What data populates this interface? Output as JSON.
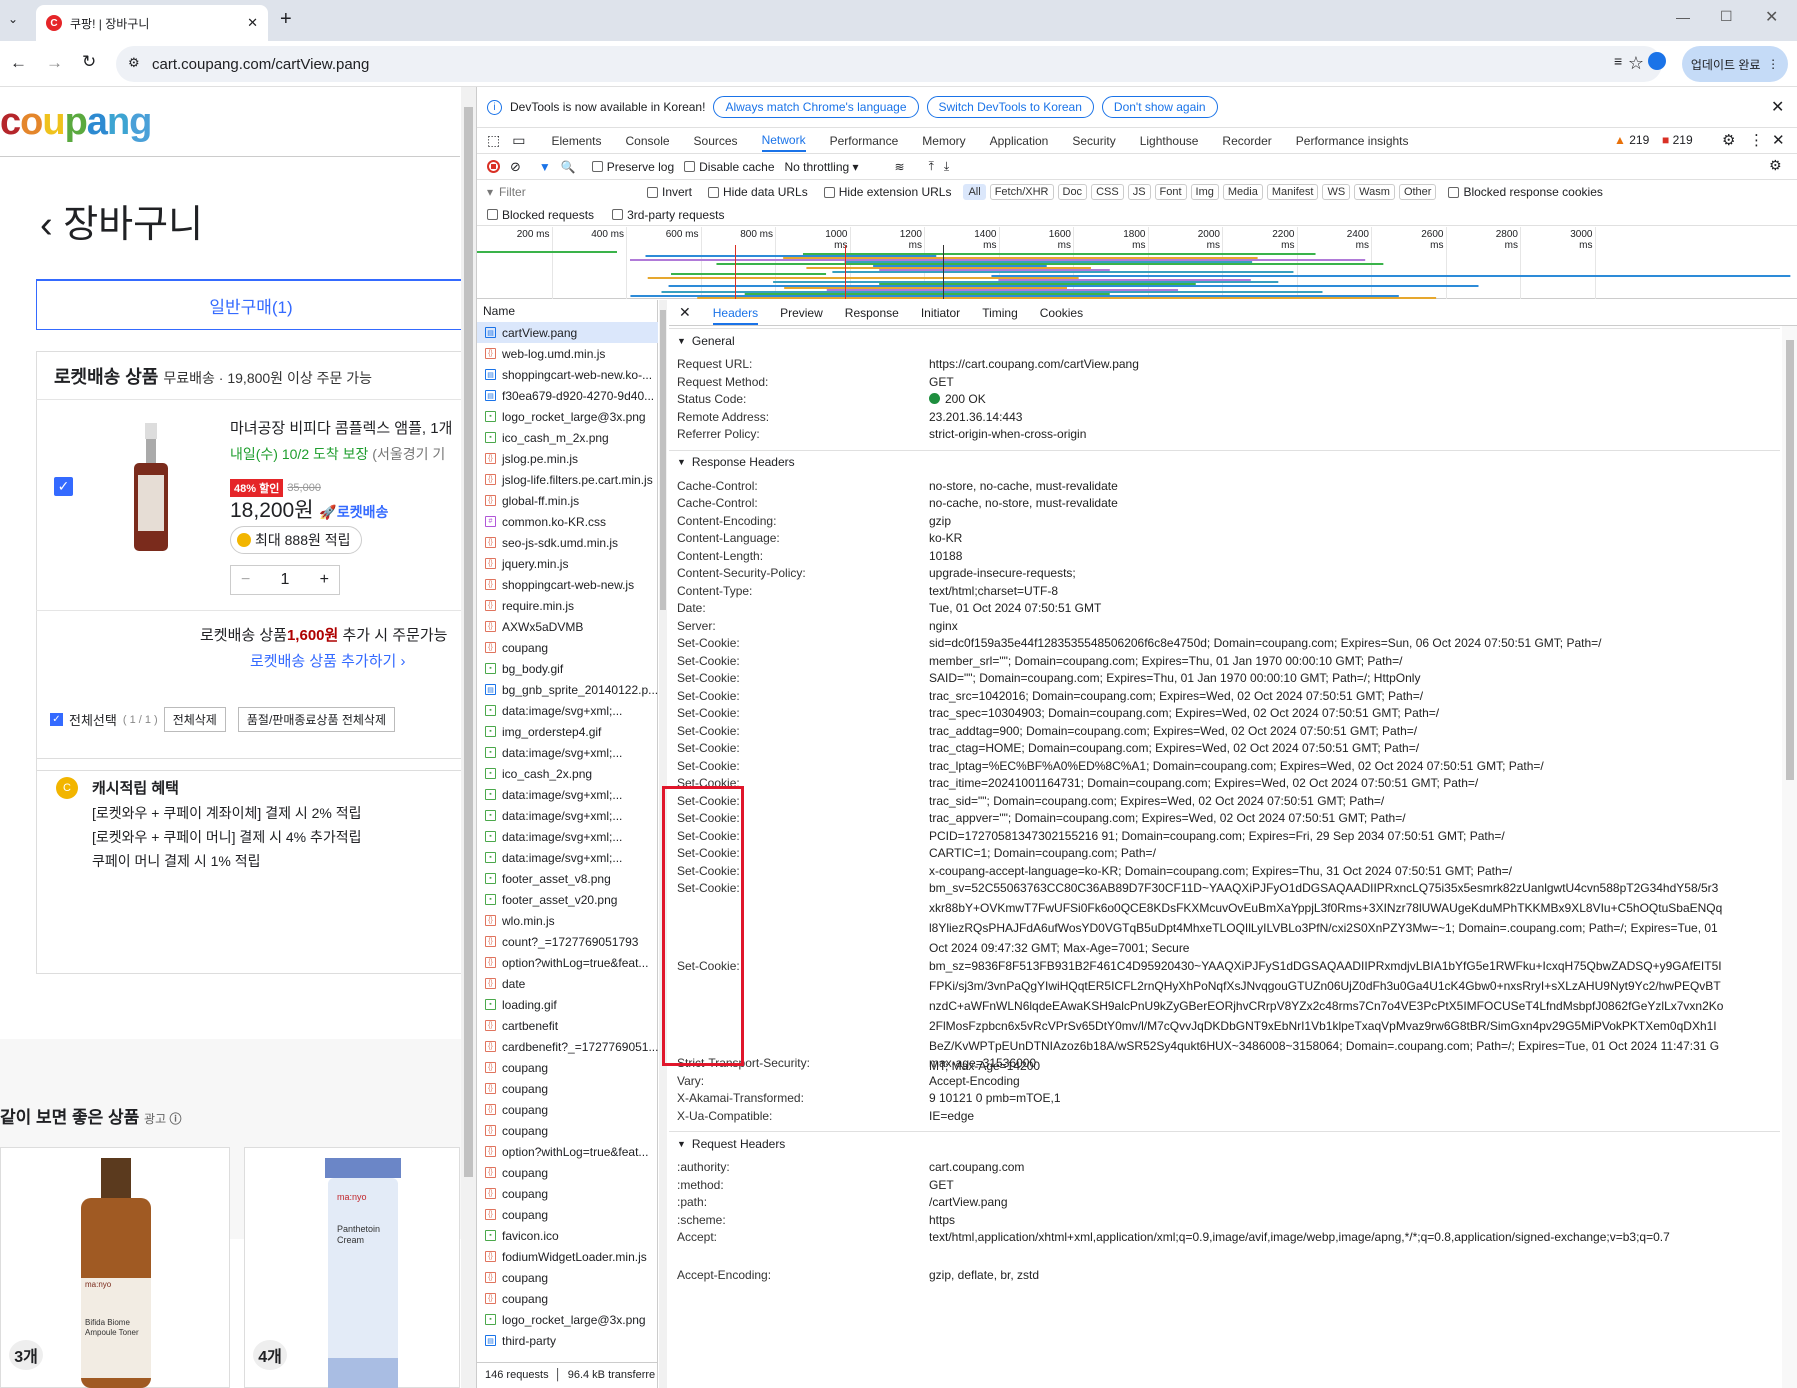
{
  "browser": {
    "tab_title": "쿠팡! | 장바구니",
    "url": "cart.coupang.com/cartView.pang",
    "update_label": "업데이트 완료"
  },
  "page": {
    "logo": "coupang",
    "heading": "장바구니",
    "tab_general": "일반구매(1)",
    "rocket_title": "로켓배송 상품",
    "rocket_sub": "무료배송 · 19,800원 이상 주문 가능",
    "product_name": "마녀공장 비피다 콤플렉스 앰플, 1개",
    "delivery": "내일(수) 10/2 도착 보장",
    "delivery_region": "(서울경기 기",
    "discount_badge": "48% 할인",
    "original_price": "35,000",
    "price": "18,200원",
    "rocket_badge": "로켓배송",
    "points": "최대 888원 적립",
    "qty": "1",
    "add_notice_a": "로켓배송 상품",
    "add_notice_amount": "1,600원",
    "add_notice_b": "추가 시 주문가능",
    "add_more": "로켓배송 상품 추가하기 ›",
    "select_all": "전체선택",
    "select_count": "( 1 / 1 )",
    "delete_all": "전체삭제",
    "delete_soldout": "품절/판매종료상품 전체삭제",
    "cash_title": "캐시적립 혜택",
    "cash_lines": [
      "[로켓와우 + 쿠페이 계좌이체] 결제 시 2% 적립",
      "[로켓와우 + 쿠페이 머니] 결제 시 4% 추가적립",
      "쿠페이 머니 결제 시 1% 적립"
    ],
    "reco_title": "같이 보면 좋은 상품",
    "reco_ad": "광고",
    "reco_counts": [
      "3개",
      "4개"
    ],
    "reco_labels": [
      "ma:nyo",
      "ma:nyo"
    ],
    "reco_names": [
      "Bifida Biome Ampoule Toner",
      "Panthetoin Cream"
    ]
  },
  "devtools": {
    "banner": "DevTools is now available in Korean!",
    "btn_match": "Always match Chrome's language",
    "btn_switch": "Switch DevTools to Korean",
    "btn_dont": "Don't show again",
    "tabs": [
      "Elements",
      "Console",
      "Sources",
      "Network",
      "Performance",
      "Memory",
      "Application",
      "Security",
      "Lighthouse",
      "Recorder",
      "Performance insights"
    ],
    "warn_count": "219",
    "err_count": "219",
    "preserve_log": "Preserve log",
    "disable_cache": "Disable cache",
    "throttling": "No throttling",
    "filter_placeholder": "Filter",
    "invert": "Invert",
    "hide_data": "Hide data URLs",
    "hide_ext": "Hide extension URLs",
    "filter_types": [
      "All",
      "Fetch/XHR",
      "Doc",
      "CSS",
      "JS",
      "Font",
      "Img",
      "Media",
      "Manifest",
      "WS",
      "Wasm",
      "Other"
    ],
    "blocked_cookies": "Blocked response cookies",
    "blocked_req": "Blocked requests",
    "third_party": "3rd-party requests",
    "timeline_ticks": [
      "200 ms",
      "400 ms",
      "600 ms",
      "800 ms",
      "1000 ms",
      "1200 ms",
      "1400 ms",
      "1600 ms",
      "1800 ms",
      "2000 ms",
      "2200 ms",
      "2400 ms",
      "2600 ms",
      "2800 ms",
      "3000 ms"
    ],
    "name_header": "Name",
    "requests": [
      "cartView.pang",
      "web-log.umd.min.js",
      "shoppingcart-web-new.ko-...",
      "f30ea679-d920-4270-9d40...",
      "logo_rocket_large@3x.png",
      "ico_cash_m_2x.png",
      "jslog.pe.min.js",
      "jslog-life.filters.pe.cart.min.js",
      "global-ff.min.js",
      "common.ko-KR.css",
      "seo-js-sdk.umd.min.js",
      "jquery.min.js",
      "shoppingcart-web-new.js",
      "require.min.js",
      "AXWx5aDVMB",
      "coupang",
      "bg_body.gif",
      "bg_gnb_sprite_20140122.p...",
      "data:image/svg+xml;...",
      "img_orderstep4.gif",
      "data:image/svg+xml;...",
      "ico_cash_2x.png",
      "data:image/svg+xml;...",
      "data:image/svg+xml;...",
      "data:image/svg+xml;...",
      "data:image/svg+xml;...",
      "footer_asset_v8.png",
      "footer_asset_v20.png",
      "wlo.min.js",
      "count?_=1727769051793",
      "option?withLog=true&feat...",
      "date",
      "loading.gif",
      "cartbenefit",
      "cardbenefit?_=1727769051...",
      "coupang",
      "coupang",
      "coupang",
      "coupang",
      "option?withLog=true&feat...",
      "coupang",
      "coupang",
      "coupang",
      "favicon.ico",
      "fodiumWidgetLoader.min.js",
      "coupang",
      "coupang",
      "logo_rocket_large@3x.png",
      "third-party"
    ],
    "summary_requests": "146 requests",
    "summary_transferred": "96.4 kB transferre",
    "detail_tabs": [
      "Headers",
      "Preview",
      "Response",
      "Initiator",
      "Timing",
      "Cookies"
    ],
    "general_title": "General",
    "general": [
      [
        "Request URL:",
        "https://cart.coupang.com/cartView.pang"
      ],
      [
        "Request Method:",
        "GET"
      ],
      [
        "Status Code:",
        "200 OK"
      ],
      [
        "Remote Address:",
        "23.201.36.14:443"
      ],
      [
        "Referrer Policy:",
        "strict-origin-when-cross-origin"
      ]
    ],
    "response_title": "Response Headers",
    "response": [
      [
        "Cache-Control:",
        "no-store, no-cache, must-revalidate"
      ],
      [
        "Cache-Control:",
        "no-cache, no-store, must-revalidate"
      ],
      [
        "Content-Encoding:",
        "gzip"
      ],
      [
        "Content-Language:",
        "ko-KR"
      ],
      [
        "Content-Length:",
        "10188"
      ],
      [
        "Content-Security-Policy:",
        "upgrade-insecure-requests;"
      ],
      [
        "Content-Type:",
        "text/html;charset=UTF-8"
      ],
      [
        "Date:",
        "Tue, 01 Oct 2024 07:50:51 GMT"
      ],
      [
        "Server:",
        "nginx"
      ],
      [
        "Set-Cookie:",
        "sid=dc0f159a35e44f1283535548506206f6c8e4750d; Domain=coupang.com; Expires=Sun, 06 Oct 2024 07:50:51 GMT; Path=/"
      ],
      [
        "Set-Cookie:",
        "member_srl=\"\"; Domain=coupang.com; Expires=Thu, 01 Jan 1970 00:00:10 GMT; Path=/"
      ],
      [
        "Set-Cookie:",
        "SAID=\"\"; Domain=coupang.com; Expires=Thu, 01 Jan 1970 00:00:10 GMT; Path=/; HttpOnly"
      ],
      [
        "Set-Cookie:",
        "trac_src=1042016; Domain=coupang.com; Expires=Wed, 02 Oct 2024 07:50:51 GMT; Path=/"
      ],
      [
        "Set-Cookie:",
        "trac_spec=10304903; Domain=coupang.com; Expires=Wed, 02 Oct 2024 07:50:51 GMT; Path=/"
      ],
      [
        "Set-Cookie:",
        "trac_addtag=900; Domain=coupang.com; Expires=Wed, 02 Oct 2024 07:50:51 GMT; Path=/"
      ],
      [
        "Set-Cookie:",
        "trac_ctag=HOME; Domain=coupang.com; Expires=Wed, 02 Oct 2024 07:50:51 GMT; Path=/"
      ],
      [
        "Set-Cookie:",
        "trac_lptag=%EC%BF%A0%ED%8C%A1; Domain=coupang.com; Expires=Wed, 02 Oct 2024 07:50:51 GMT; Path=/"
      ],
      [
        "Set-Cookie:",
        "trac_itime=20241001164731; Domain=coupang.com; Expires=Wed, 02 Oct 2024 07:50:51 GMT; Path=/"
      ],
      [
        "Set-Cookie:",
        "trac_sid=\"\"; Domain=coupang.com; Expires=Wed, 02 Oct 2024 07:50:51 GMT; Path=/"
      ],
      [
        "Set-Cookie:",
        "trac_appver=\"\"; Domain=coupang.com; Expires=Wed, 02 Oct 2024 07:50:51 GMT; Path=/"
      ],
      [
        "Set-Cookie:",
        "PCID=17270581347302155216 91; Domain=coupang.com; Expires=Fri, 29 Sep 2034 07:50:51 GMT; Path=/"
      ],
      [
        "Set-Cookie:",
        "CARTIC=1; Domain=coupang.com; Path=/"
      ],
      [
        "Set-Cookie:",
        "x-coupang-accept-language=ko-KR; Domain=coupang.com; Expires=Thu, 31 Oct 2024 07:50:51 GMT; Path=/"
      ],
      [
        "Set-Cookie:",
        "bm_sv=52C55063763CC80C36AB89D7F30CF11D~YAAQXiPJFyO1dDGSAQAADIIPRxncLQ75i35x5esmrk82zUanlgwtU4cvn588pT2G34hdY58/5r3xkr88bY+OVKmwT7FwUFSi0Fk6o0QCE8KDsFKXMcuvOvEuBmXaYppjL3f0Rms+3XINzr78lUWAUgeKduMPhTKKMBx9XL8VIu+C5hOQtuSbaENQql8YliezRQsPHAJFdA6ufWosYD0VGTqB5uDpt4MhxeTLOQIlLyILVBLo3PfN/cxi2S0XnPZY3Mw=~1; Domain=.coupang.com; Path=/; Expires=Tue, 01 Oct 2024 09:47:32 GMT; Max-Age=7001; Secure"
      ],
      [
        "Set-Cookie:",
        "bm_sz=9836F8F513FB931B2F461C4D95920430~YAAQXiPJFyS1dDGSAQAADIIPRxmdjvLBIA1bYfG5e1RWFku+IcxqH75QbwZADSQ+y9GAfEIT5IFPKi/sj3m/3vnPaQgYIwiHQqtER5ICFL2rnQHyXhPoNqfXsJNvqgouGTUZn06UjZ0dFh3u0Ga4U1cK4Gbw0+nxsRryI+sXLzAHU9Nyt9Yc2/hwPEQvBTnzdC+aWFnWLN6lqdeEAwaKSH9alcPnU9kZyGBerEORjhvCRrpV8YZx2c48rms7Cn7o4VE3PcPtX5IMFOCUSeT4LfndMsbpfJ0862fGeYzlLx7vxn2Ko2FlMosFzpbcn6x5vRcVPrSv65DtY0mv/l/M7cQvvJqDKDbGNT9xEbNrI1Vb1klpeTxaqVpMvaz9rw6G8tBR/SimGxn4pv29G5MiPVokPKTXem0qDXh1IBeZ/KvWPTpEUnDTNIAzoz6b18A/wSR52Sy4qukt6HUX~3486008~3158064; Domain=.coupang.com; Path=/; Expires=Tue, 01 Oct 2024 11:47:31 GMT; Max-Age=14200"
      ],
      [
        "Strict-Transport-Security:",
        "max-age=31536000"
      ],
      [
        "Vary:",
        "Accept-Encoding"
      ],
      [
        "X-Akamai-Transformed:",
        "9 10121 0 pmb=mTOE,1"
      ],
      [
        "X-Ua-Compatible:",
        "IE=edge"
      ]
    ],
    "request_title": "Request Headers",
    "request": [
      [
        ":authority:",
        "cart.coupang.com"
      ],
      [
        ":method:",
        "GET"
      ],
      [
        ":path:",
        "/cartView.pang"
      ],
      [
        ":scheme:",
        "https"
      ],
      [
        "Accept:",
        "text/html,application/xhtml+xml,application/xml;q=0.9,image/avif,image/webp,image/apng,*/*;q=0.8,application/signed-exchange;v=b3;q=0.7"
      ],
      [
        "Accept-Encoding:",
        "gzip, deflate, br, zstd"
      ]
    ]
  },
  "colors": {
    "coupang_c": "#b5262b",
    "coupang_o": "#e4862b",
    "coupang_u": "#efc21d",
    "coupang_p": "#5aa93f",
    "coupang_a": "#2d8ad1",
    "coupang_n": "#3da4d2",
    "coupang_g": "#4aa0d8",
    "accent": "#1a73e8",
    "highlight_box": "#e0162b"
  }
}
